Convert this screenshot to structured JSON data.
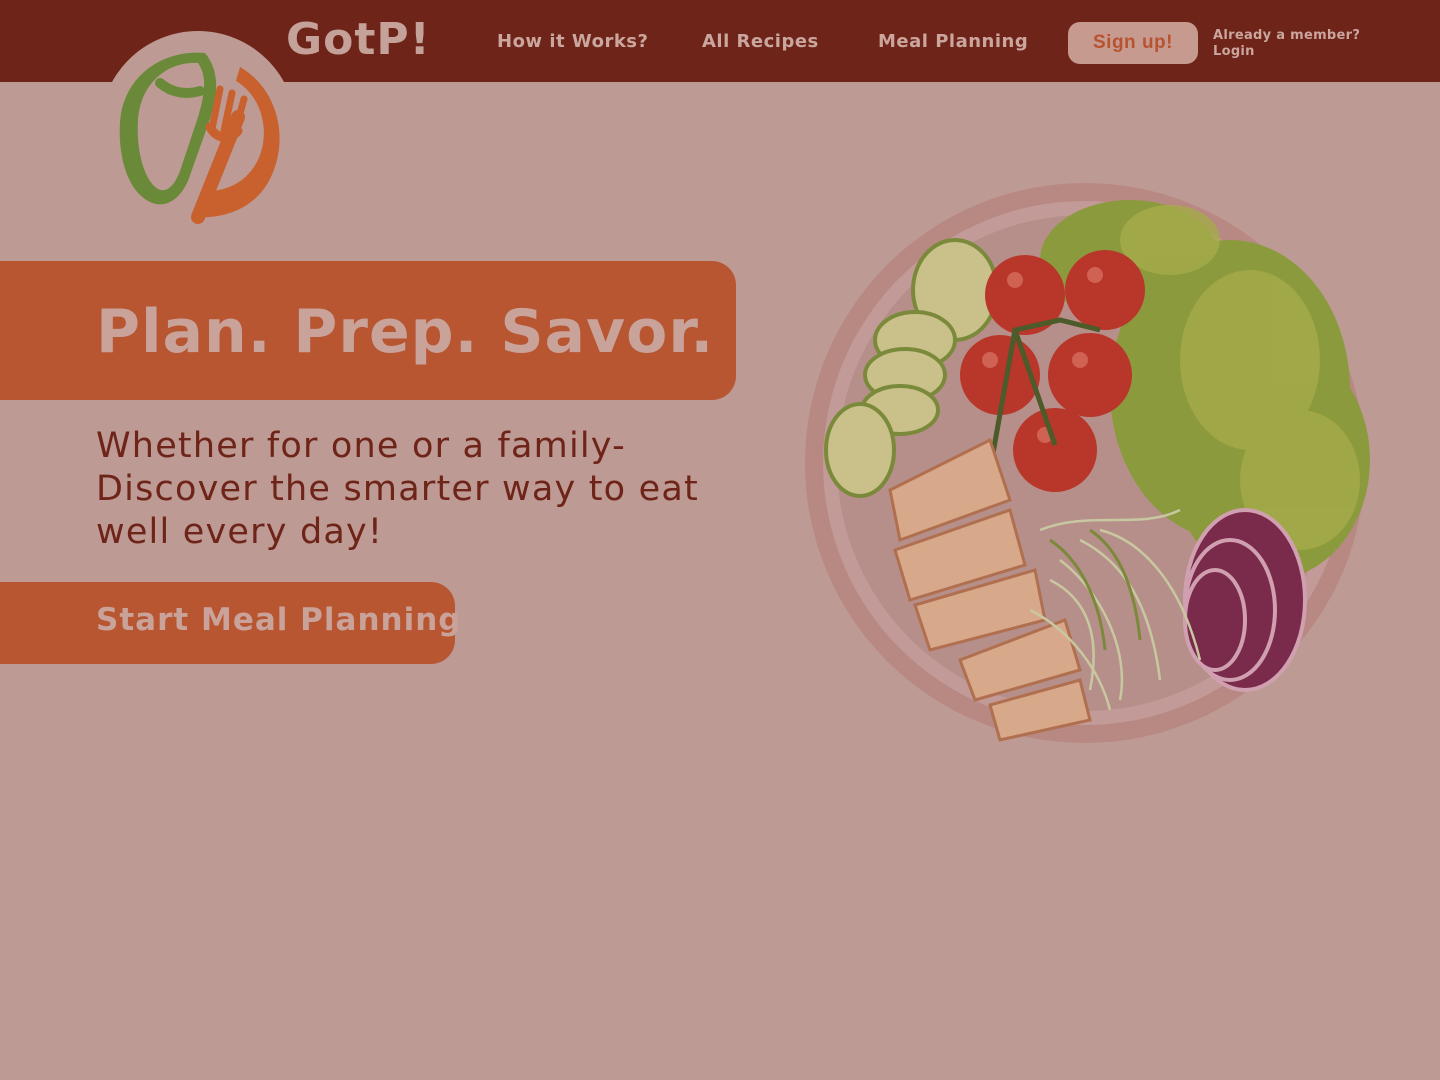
{
  "header": {
    "brand": "GotP!",
    "nav": [
      {
        "label": "How it Works?"
      },
      {
        "label": "All Recipes"
      },
      {
        "label": "Meal Planning"
      }
    ],
    "signup_label": "Sign up!",
    "member_prompt": "Already a member?",
    "login_label": "Login"
  },
  "hero": {
    "title": "Plan. Prep. Savor.",
    "subtitle_lines": [
      "Whether for one or a family-",
      "Discover the smarter way to eat",
      "well every day!"
    ],
    "cta_label": "Start Meal Planning"
  },
  "colors": {
    "topbar": "#6e2418",
    "background": "#bd9a93",
    "accent": "#b85632"
  },
  "icons": {
    "logo": "leaf-fork-logo-icon"
  }
}
